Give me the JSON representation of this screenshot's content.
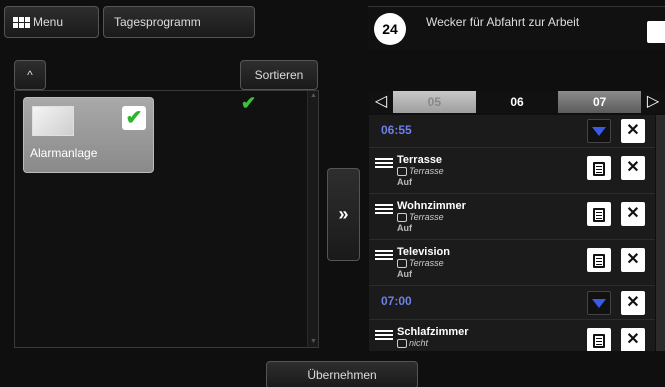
{
  "top": {
    "menu_label": "Menu",
    "tagesprogramm_label": "Tagesprogramm"
  },
  "left": {
    "up_label": "^",
    "sort_label": "Sortieren",
    "tile": {
      "label": "Alarmanlage",
      "checked": true
    }
  },
  "transfer_label": "»",
  "right": {
    "badge": "24",
    "title": "Wecker für Abfahrt zur Arbeit",
    "days": {
      "prev": "◁",
      "d1": "05",
      "d2": "06",
      "d3": "07",
      "next": "▷"
    },
    "times": [
      "06:55",
      "07:00"
    ],
    "devices": [
      {
        "name": "Terrasse",
        "room": "Terrasse",
        "state": "Auf"
      },
      {
        "name": "Wohnzimmer",
        "room": "Terrasse",
        "state": "Auf"
      },
      {
        "name": "Television",
        "room": "Terrasse",
        "state": "Auf"
      },
      {
        "name": "Schlafzimmer",
        "room": "nicht",
        "state": ""
      }
    ],
    "close_label": "✕"
  },
  "bottom": {
    "apply_label": "Übernehmen"
  },
  "colors": {
    "time_blue": "#6f7fe8",
    "check_green": "#3cc23c",
    "arrow_blue": "#3a5be8"
  }
}
